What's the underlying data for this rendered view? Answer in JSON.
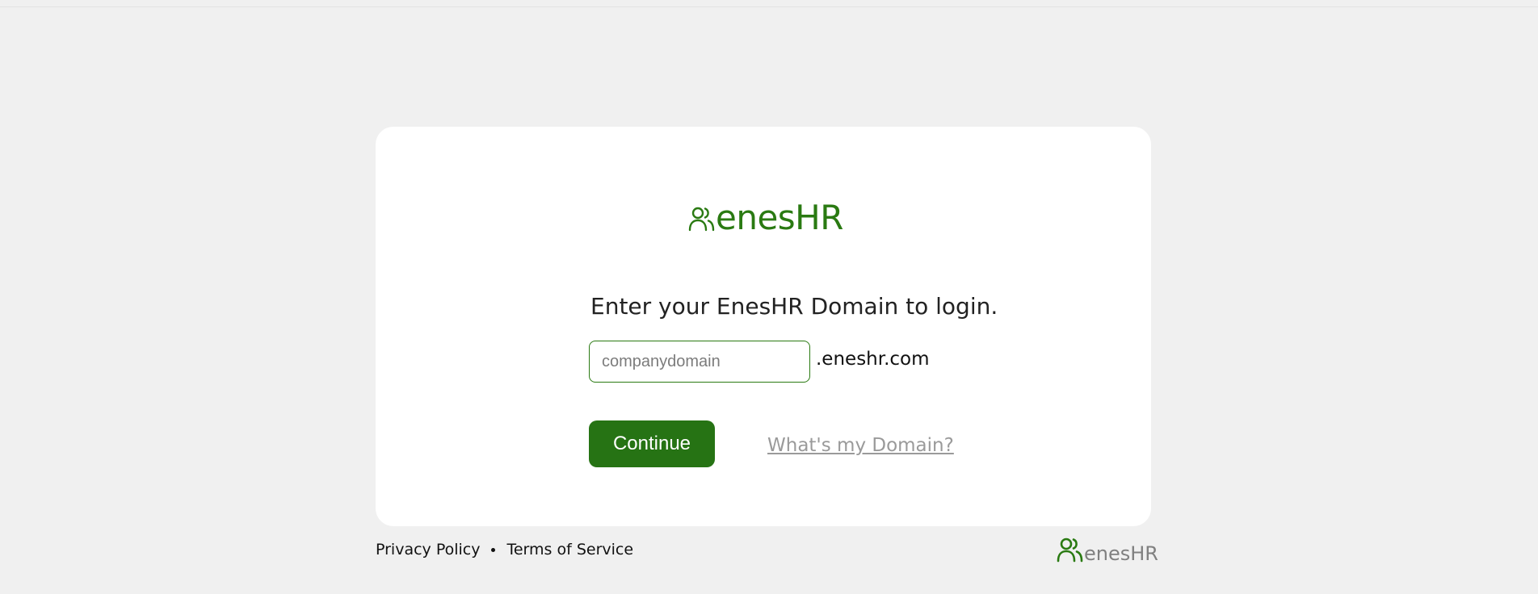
{
  "brand": {
    "logo_text": "enesHR",
    "accent_color": "#267314",
    "logo_icon": "people-icon"
  },
  "login": {
    "prompt": "Enter your EnesHR Domain to login.",
    "domain_placeholder": "companydomain",
    "domain_value": "",
    "domain_suffix": ".eneshr.com",
    "continue_label": "Continue",
    "help_link": "What's my Domain?"
  },
  "footer": {
    "privacy_label": "Privacy Policy",
    "terms_label": "Terms of Service",
    "logo_text": "enesHR"
  }
}
